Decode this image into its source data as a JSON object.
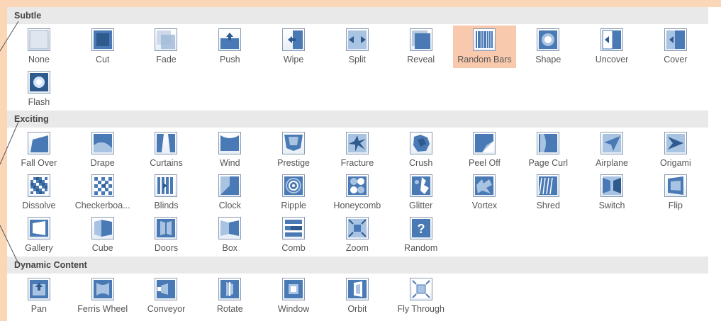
{
  "sections": [
    {
      "title": "Subtle",
      "rows": [
        [
          {
            "label": "None",
            "icon": "none-icon"
          },
          {
            "label": "Cut",
            "icon": "cut-icon"
          },
          {
            "label": "Fade",
            "icon": "fade-icon"
          },
          {
            "label": "Push",
            "icon": "push-icon"
          },
          {
            "label": "Wipe",
            "icon": "wipe-icon"
          },
          {
            "label": "Split",
            "icon": "split-icon"
          },
          {
            "label": "Reveal",
            "icon": "reveal-icon"
          },
          {
            "label": "Random Bars",
            "icon": "random-bars-icon",
            "selected": true
          },
          {
            "label": "Shape",
            "icon": "shape-icon"
          },
          {
            "label": "Uncover",
            "icon": "uncover-icon"
          },
          {
            "label": "Cover",
            "icon": "cover-icon"
          }
        ],
        [
          {
            "label": "Flash",
            "icon": "flash-icon"
          }
        ]
      ]
    },
    {
      "title": "Exciting",
      "rows": [
        [
          {
            "label": "Fall Over",
            "icon": "fall-over-icon"
          },
          {
            "label": "Drape",
            "icon": "drape-icon"
          },
          {
            "label": "Curtains",
            "icon": "curtains-icon"
          },
          {
            "label": "Wind",
            "icon": "wind-icon"
          },
          {
            "label": "Prestige",
            "icon": "prestige-icon"
          },
          {
            "label": "Fracture",
            "icon": "fracture-icon"
          },
          {
            "label": "Crush",
            "icon": "crush-icon"
          },
          {
            "label": "Peel Off",
            "icon": "peel-off-icon"
          },
          {
            "label": "Page Curl",
            "icon": "page-curl-icon"
          },
          {
            "label": "Airplane",
            "icon": "airplane-icon"
          },
          {
            "label": "Origami",
            "icon": "origami-icon"
          }
        ],
        [
          {
            "label": "Dissolve",
            "icon": "dissolve-icon"
          },
          {
            "label": "Checkerboa...",
            "icon": "checkerboard-icon"
          },
          {
            "label": "Blinds",
            "icon": "blinds-icon"
          },
          {
            "label": "Clock",
            "icon": "clock-icon"
          },
          {
            "label": "Ripple",
            "icon": "ripple-icon"
          },
          {
            "label": "Honeycomb",
            "icon": "honeycomb-icon"
          },
          {
            "label": "Glitter",
            "icon": "glitter-icon"
          },
          {
            "label": "Vortex",
            "icon": "vortex-icon"
          },
          {
            "label": "Shred",
            "icon": "shred-icon"
          },
          {
            "label": "Switch",
            "icon": "switch-icon"
          },
          {
            "label": "Flip",
            "icon": "flip-icon"
          }
        ],
        [
          {
            "label": "Gallery",
            "icon": "gallery-icon"
          },
          {
            "label": "Cube",
            "icon": "cube-icon"
          },
          {
            "label": "Doors",
            "icon": "doors-icon"
          },
          {
            "label": "Box",
            "icon": "box-icon"
          },
          {
            "label": "Comb",
            "icon": "comb-icon"
          },
          {
            "label": "Zoom",
            "icon": "zoom-icon"
          },
          {
            "label": "Random",
            "icon": "random-icon"
          }
        ]
      ]
    },
    {
      "title": "Dynamic Content",
      "rows": [
        [
          {
            "label": "Pan",
            "icon": "pan-icon"
          },
          {
            "label": "Ferris Wheel",
            "icon": "ferris-wheel-icon"
          },
          {
            "label": "Conveyor",
            "icon": "conveyor-icon"
          },
          {
            "label": "Rotate",
            "icon": "rotate-icon"
          },
          {
            "label": "Window",
            "icon": "window-icon"
          },
          {
            "label": "Orbit",
            "icon": "orbit-icon"
          },
          {
            "label": "Fly Through",
            "icon": "fly-through-icon"
          }
        ]
      ]
    }
  ],
  "colors": {
    "background": "#fbd7b8",
    "selected": "#f9c9ae",
    "icon_blue": "#4a7ab5",
    "icon_dark": "#2e5a8e"
  }
}
